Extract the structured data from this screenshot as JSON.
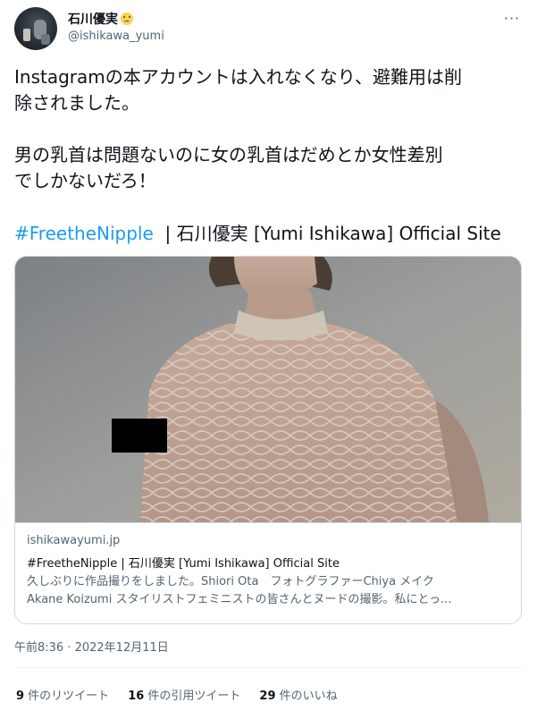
{
  "author": {
    "display_name": "石川優実",
    "handle": "@ishikawa_yumi",
    "emoji_icon": "pleading-face-emoji",
    "avatar_icon": "profile-photo"
  },
  "more_icon": "more-horizontal-icon",
  "tweet": {
    "line1": "Instagramの本アカウントは入れなくなり、避難用は削",
    "line2": "除されました。",
    "line3": "男の乳首は問題ないのに女の乳首はだめとか女性差別",
    "line4": "でしかないだろ！",
    "hashtag": "#FreetheNipple",
    "after_hashtag": "  | 石川優実 [Yumi Ishikawa] Official Site"
  },
  "card": {
    "domain": "ishikawayumi.jp",
    "title": "#FreetheNipple | 石川優実 [Yumi Ishikawa] Official Site",
    "desc_line1": "久しぶりに作品撮りをしました。Shiori Ota　フォトグラファーChiya メイク",
    "desc_line2": "Akane Koizumi スタイリストフェミニストの皆さんとヌードの撮影。私にとっ..."
  },
  "timestamp": "午前8:36 · 2022年12月11日",
  "stats": {
    "retweets_count": "9",
    "retweets_label": " 件のリツイート",
    "quotes_count": "16",
    "quotes_label": " 件の引用ツイート",
    "likes_count": "29",
    "likes_label": " 件のいいね"
  },
  "colors": {
    "link": "#1d9bf0",
    "text": "#0f1419",
    "secondary": "#536471",
    "border": "#cfd9de"
  }
}
